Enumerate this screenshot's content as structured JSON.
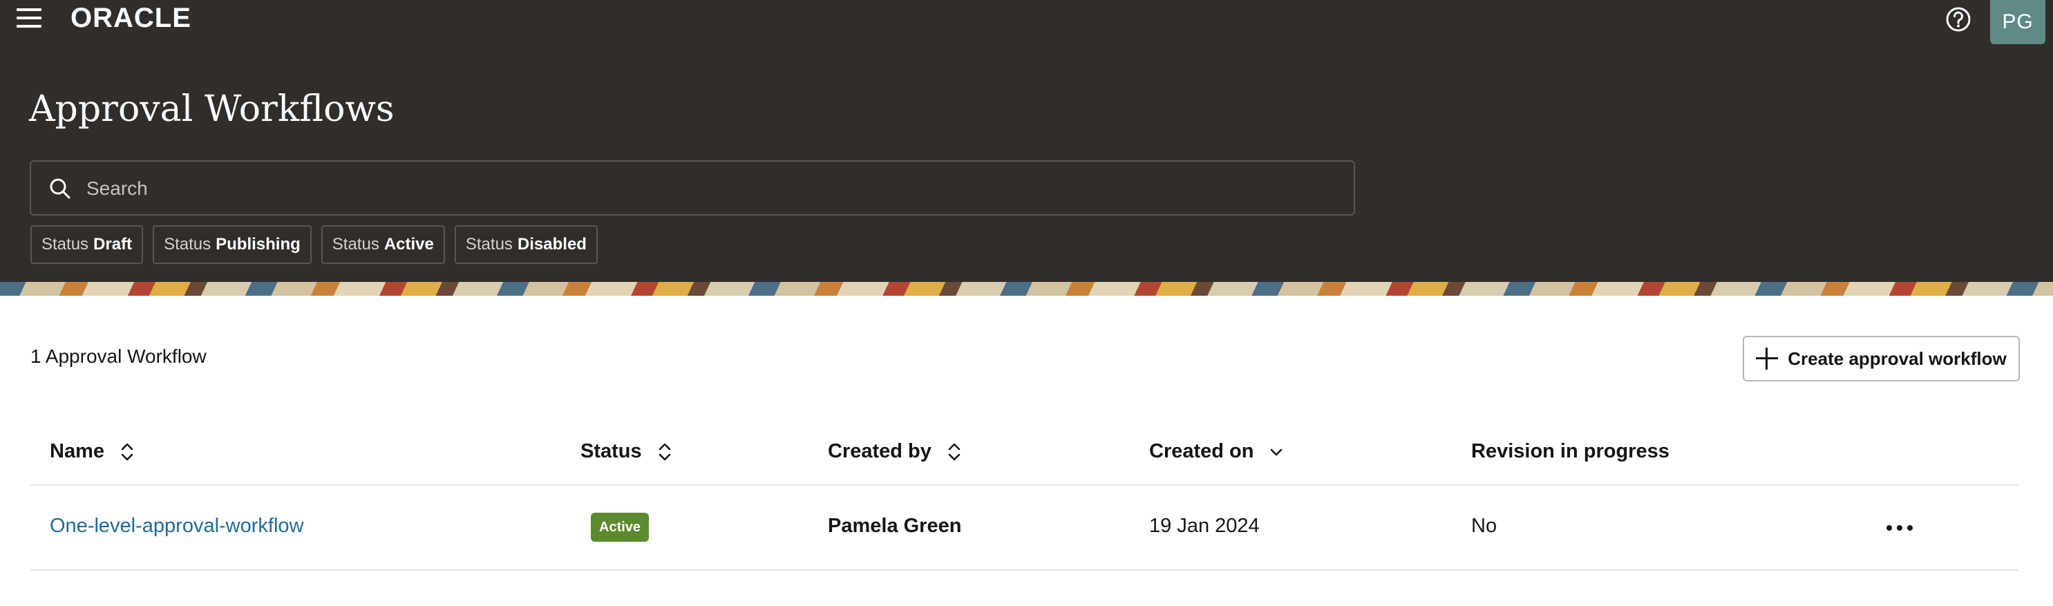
{
  "header": {
    "brand": "ORACLE",
    "avatar_initials": "PG",
    "page_title": "Approval Workflows",
    "background_color": "#312d2a"
  },
  "search": {
    "placeholder": "Search",
    "value": ""
  },
  "filters": [
    {
      "label": "Status",
      "value": "Draft"
    },
    {
      "label": "Status",
      "value": "Publishing"
    },
    {
      "label": "Status",
      "value": "Active"
    },
    {
      "label": "Status",
      "value": "Disabled"
    }
  ],
  "content": {
    "count_label": "1 Approval Workflow",
    "create_button_label": "Create approval workflow"
  },
  "table": {
    "columns": [
      {
        "label": "Name",
        "sort": "sortable"
      },
      {
        "label": "Status",
        "sort": "sortable"
      },
      {
        "label": "Created by",
        "sort": "sortable"
      },
      {
        "label": "Created on",
        "sort": "descending"
      },
      {
        "label": "Revision in progress",
        "sort": "none"
      }
    ],
    "rows": [
      {
        "name": "One-level-approval-workflow",
        "status": "Active",
        "created_by": "Pamela Green",
        "created_on": "19 Jan 2024",
        "revision_in_progress": "No"
      }
    ]
  },
  "colors": {
    "link": "#1e6a96",
    "status_active": "#5c8a2f",
    "avatar": "#5f8a86"
  }
}
